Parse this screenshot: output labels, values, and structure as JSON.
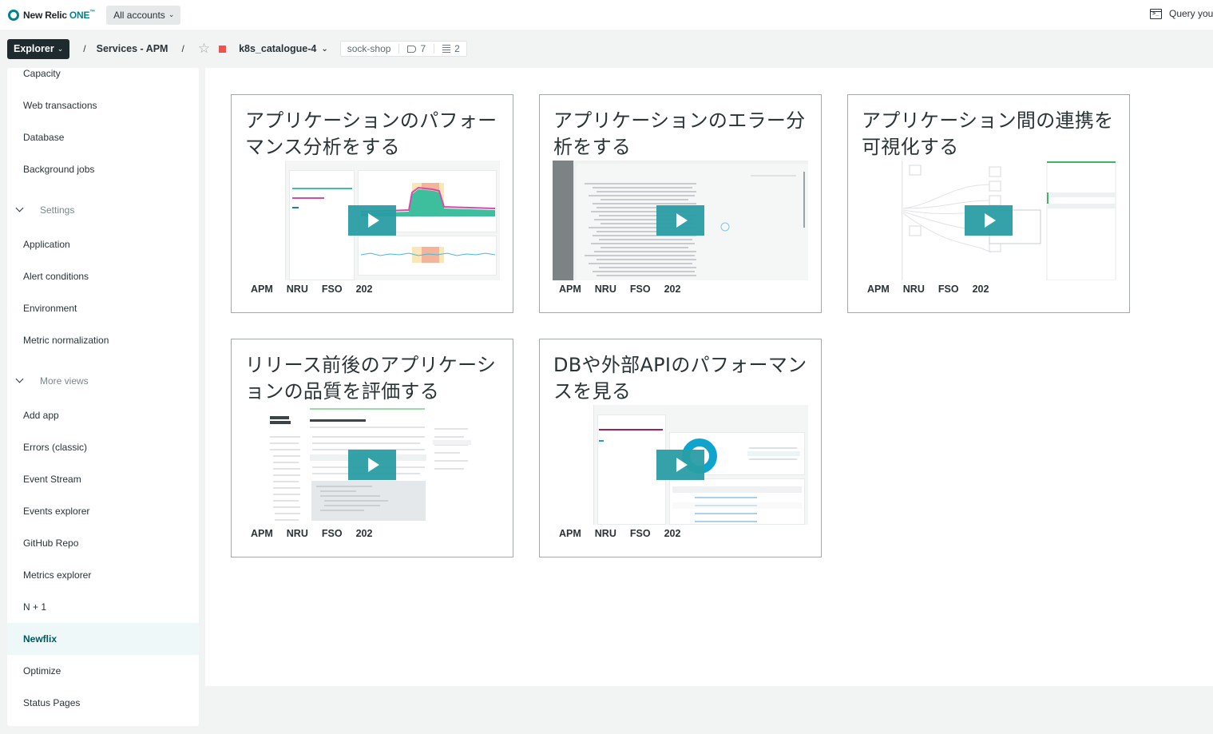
{
  "topbar": {
    "logo_text": "New Relic",
    "logo_one": "ONE",
    "logo_tm": "™",
    "accounts_label": "All accounts",
    "query_label": "Query your data"
  },
  "breadcrumb": {
    "explorer_label": "Explorer",
    "separator": "/",
    "services_label": "Services - APM",
    "entity_name": "k8s_catalogue-4",
    "entity_status_color": "#ef5350",
    "tag_account": "sock-shop",
    "tag_count": "7",
    "workload_count": "2"
  },
  "sidebar": {
    "items_top": [
      "Capacity",
      "Web transactions",
      "Database",
      "Background jobs"
    ],
    "settings_group": "Settings",
    "settings_items": [
      "Application",
      "Alert conditions",
      "Environment",
      "Metric normalization"
    ],
    "more_group": "More views",
    "more_items": [
      "Add app",
      "Errors (classic)",
      "Event Stream",
      "Events explorer",
      "GitHub Repo",
      "Metrics explorer",
      "N + 1",
      "Newflix",
      "Optimize",
      "Status Pages"
    ],
    "active_item": "Newflix"
  },
  "cards": [
    {
      "title": "アプリケーションのパフォーマンス分析をする",
      "tags": [
        "APM",
        "NRU",
        "FSO",
        "202"
      ],
      "thumb": "performance"
    },
    {
      "title": "アプリケーションのエラー分析をする",
      "tags": [
        "APM",
        "NRU",
        "FSO",
        "202"
      ],
      "thumb": "errors"
    },
    {
      "title": "アプリケーション間の連携を可視化する",
      "tags": [
        "APM",
        "NRU",
        "FSO",
        "202"
      ],
      "thumb": "servicemap"
    },
    {
      "title": "リリース前後のアプリケーションの品質を評価する",
      "tags": [
        "APM",
        "NRU",
        "FSO",
        "202"
      ],
      "thumb": "docs"
    },
    {
      "title": "DBや外部APIのパフォーマンスを見る",
      "tags": [
        "APM",
        "NRU",
        "FSO",
        "202"
      ],
      "thumb": "database"
    }
  ],
  "colors": {
    "brand": "#00838f",
    "play_button": "#2a9ea4",
    "active_bg": "#eef8f8",
    "active_text": "#00595f"
  }
}
